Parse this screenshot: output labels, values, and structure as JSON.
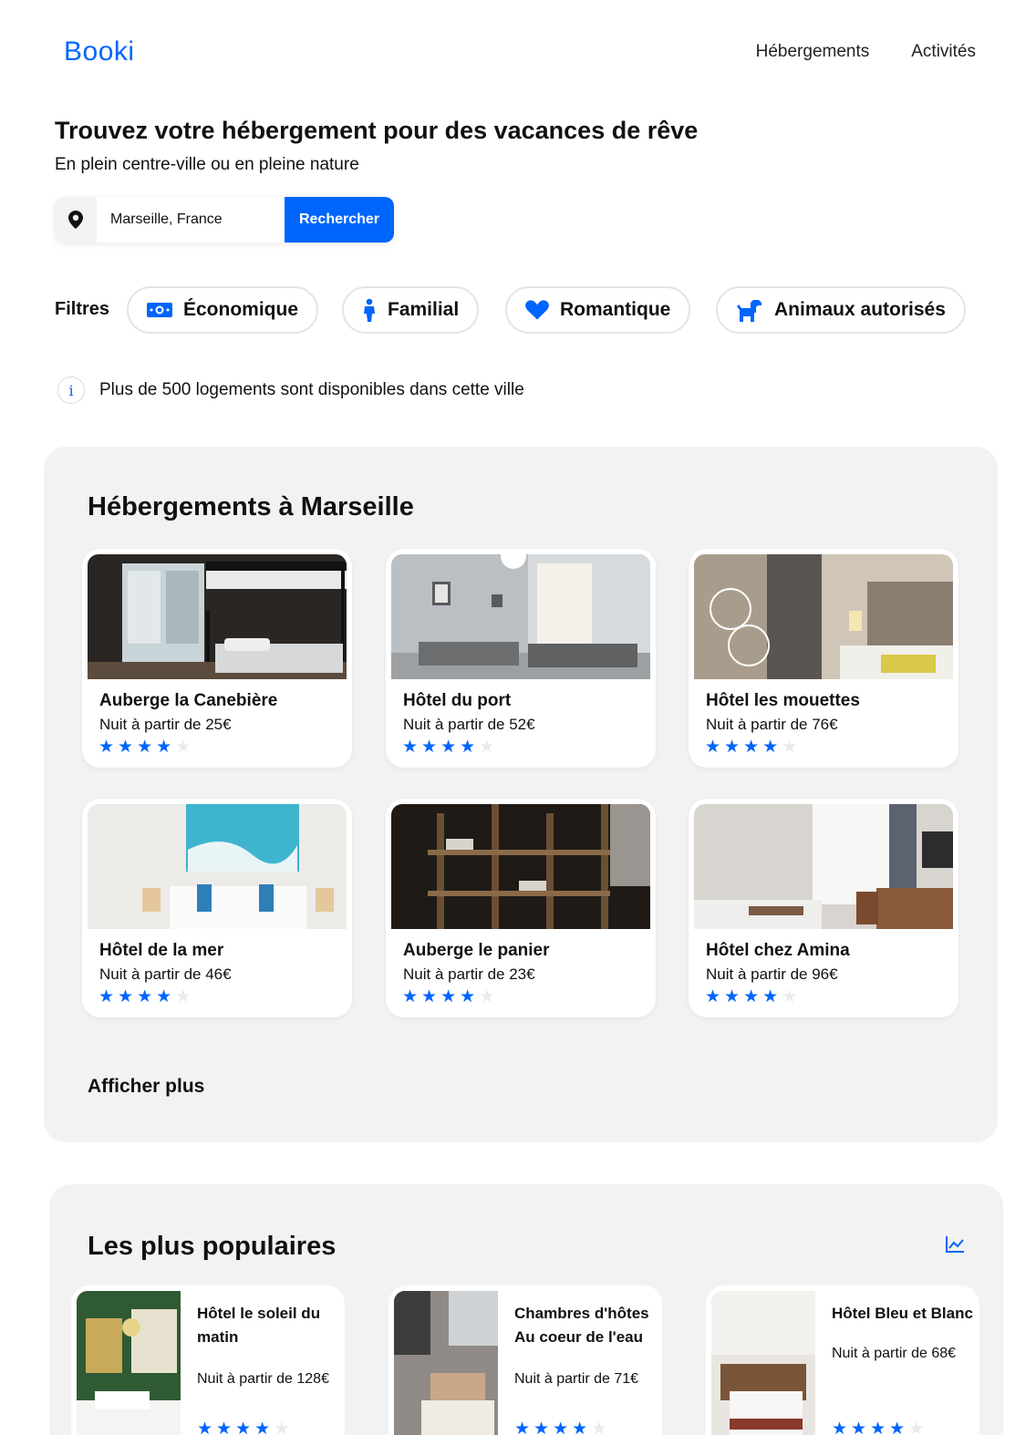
{
  "header": {
    "logo": "Booki",
    "nav": [
      "Hébergements",
      "Activités"
    ]
  },
  "hero": {
    "title": "Trouvez votre hébergement pour des vacances de rêve",
    "subtitle": "En plein centre-ville ou en pleine nature"
  },
  "search": {
    "icon": "map-pin-icon",
    "value": "Marseille, France",
    "button_label": "Rechercher"
  },
  "filters": {
    "label": "Filtres",
    "items": [
      {
        "label": "Économique",
        "icon": "money-icon"
      },
      {
        "label": "Familial",
        "icon": "person-icon"
      },
      {
        "label": "Romantique",
        "icon": "heart-icon"
      },
      {
        "label": "Animaux autorisés",
        "icon": "dog-icon"
      }
    ]
  },
  "info": {
    "icon": "info-icon",
    "text": "Plus de 500 logements sont disponibles dans cette ville"
  },
  "lodgings": {
    "title": "Hébergements à Marseille",
    "cards": [
      {
        "name": "Auberge la Canebière",
        "price": "Nuit à partir de 25€",
        "rating": 4
      },
      {
        "name": "Hôtel du port",
        "price": "Nuit à partir de 52€",
        "rating": 4
      },
      {
        "name": "Hôtel les mouettes",
        "price": "Nuit à partir de 76€",
        "rating": 4
      },
      {
        "name": "Hôtel de la mer",
        "price": "Nuit à partir de 46€",
        "rating": 4
      },
      {
        "name": "Auberge le panier",
        "price": "Nuit à partir de 23€",
        "rating": 4
      },
      {
        "name": "Hôtel chez Amina",
        "price": "Nuit à partir de 96€",
        "rating": 4
      }
    ],
    "show_more": "Afficher plus"
  },
  "popular": {
    "title": "Les plus populaires",
    "icon": "trend-chart-icon",
    "cards": [
      {
        "name": "Hôtel le soleil du matin",
        "price": "Nuit à partir de 128€",
        "rating": 4
      },
      {
        "name": "Chambres d'hôtes Au coeur de l'eau",
        "price": "Nuit à partir de 71€",
        "rating": 4
      },
      {
        "name": "Hôtel Bleu et Blanc",
        "price": "Nuit à partir de 68€",
        "rating": 4
      }
    ]
  },
  "colors": {
    "accent": "#0065FC",
    "section_bg": "#F2F2F2",
    "star_off": "#EAEAEA"
  }
}
